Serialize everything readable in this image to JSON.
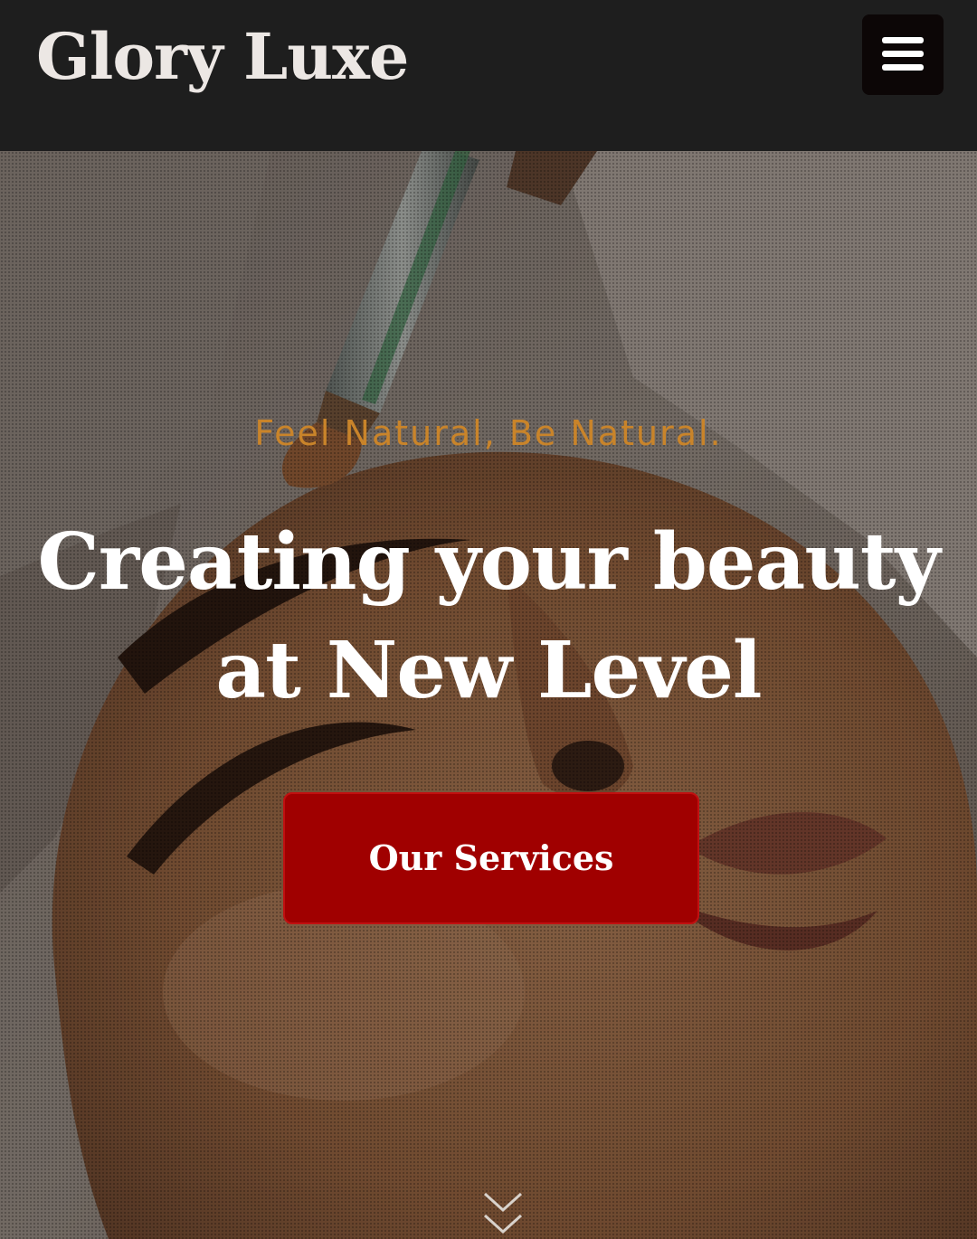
{
  "header": {
    "brand": "Glory Luxe",
    "menu_icon": "hamburger-menu-icon",
    "background": "#1e1e1e"
  },
  "hero": {
    "image": "woman receiving facial treatment with applicator brush",
    "tagline": "Feel Natural, Be Natural.",
    "headline_line1": "Creating your beauty",
    "headline_line2": "at New Level",
    "cta_label": "Our Services",
    "scroll_icon": "double-chevron-down-icon",
    "colors": {
      "tagline": "#c9842a",
      "cta": "#a00000",
      "headline": "#ffffff"
    }
  }
}
